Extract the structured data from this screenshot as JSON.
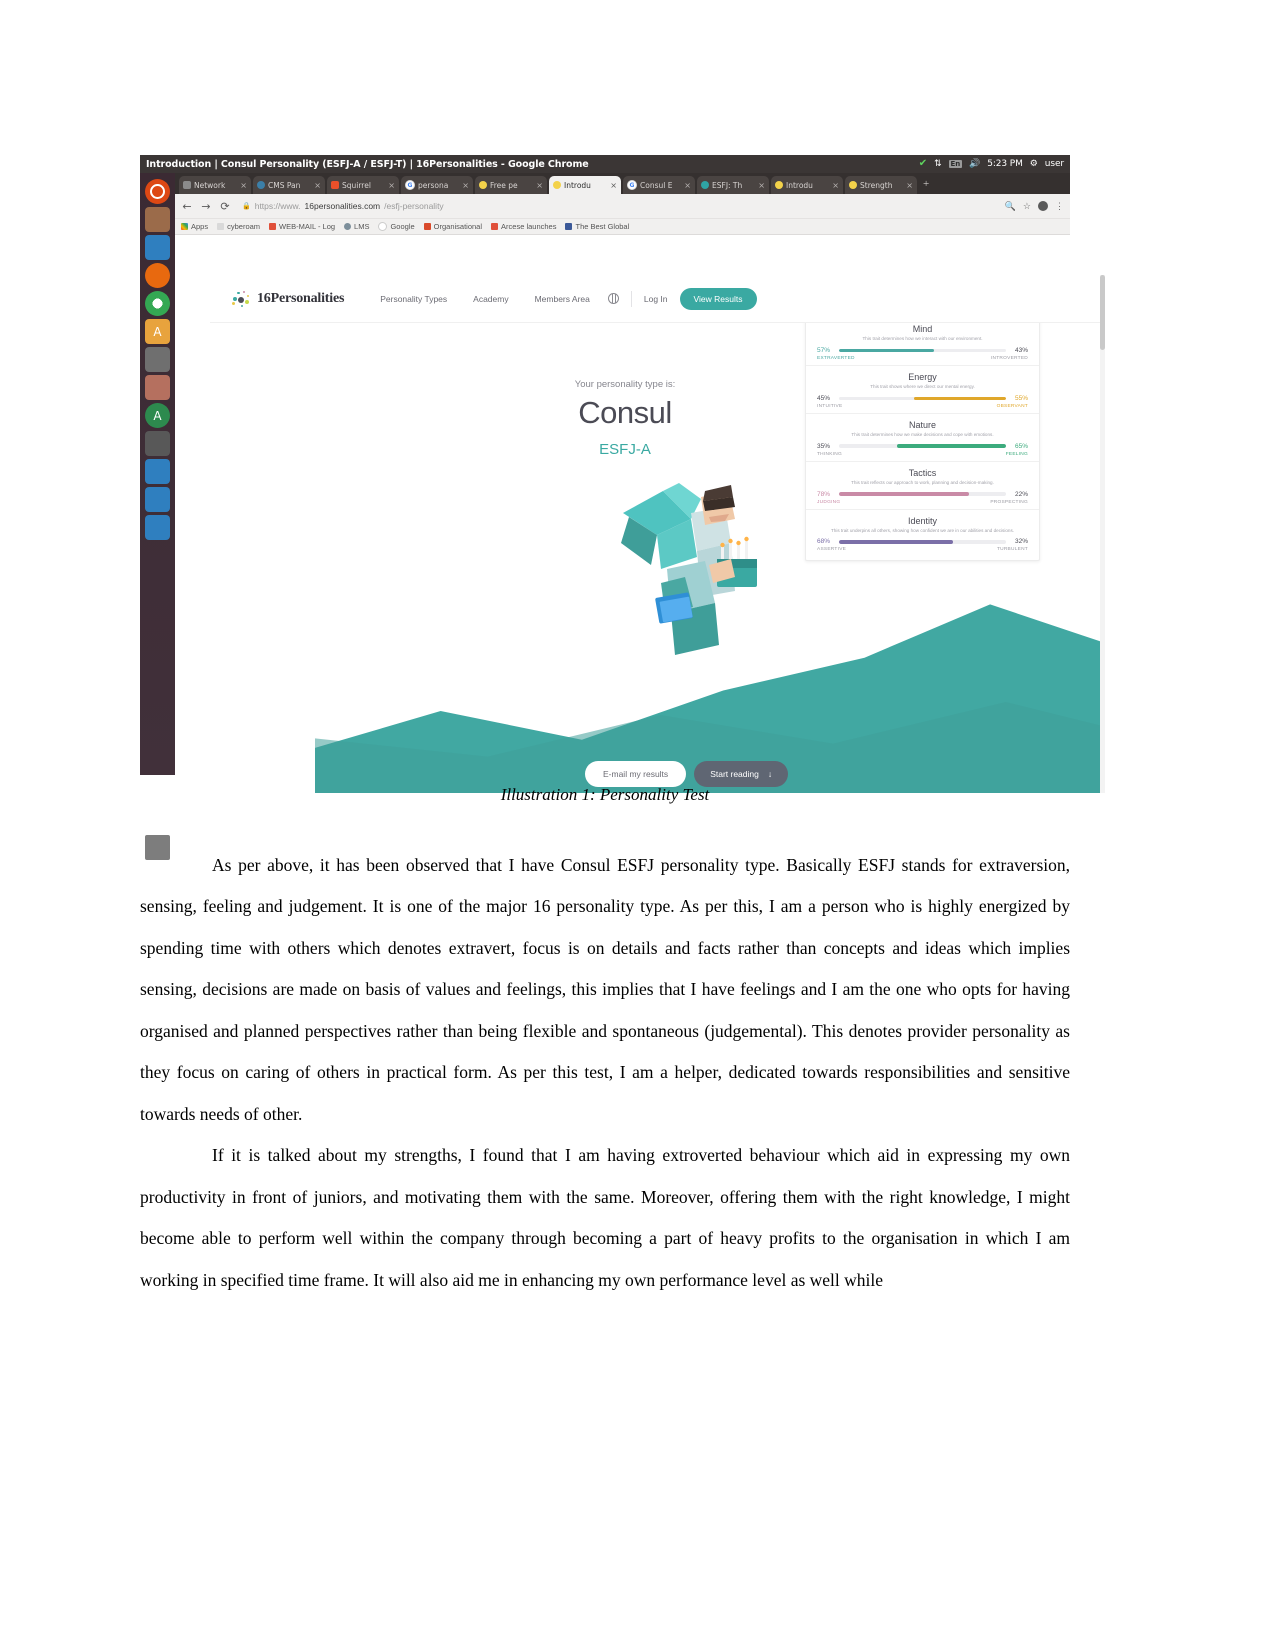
{
  "desktop": {
    "window_title": "Introduction | Consul Personality (ESFJ-A / ESFJ-T) | 16Personalities - Google Chrome",
    "clock": "5:23 PM",
    "user": "user",
    "indicators": {
      "sync": "sync-ok-icon",
      "network": "network-icon",
      "keyboard": "En",
      "volume": "volume-icon",
      "power": "power-icon"
    },
    "launcher_items": [
      "ubuntu-dash-icon",
      "files-icon",
      "folder-icon",
      "firefox-icon",
      "chrome-icon",
      "amber-app-icon",
      "wrench-icon",
      "image-app-icon",
      "android-studio-icon",
      "printer-icon",
      "blue-app-1-icon",
      "blue-app-2-icon",
      "blue-app-3-icon",
      "trash-icon"
    ]
  },
  "browser": {
    "tabs": [
      {
        "label": "Network",
        "favicon": "grey-page-icon",
        "active": false
      },
      {
        "label": "CMS Pan",
        "favicon": "cms-icon",
        "active": false
      },
      {
        "label": "Squirrel",
        "favicon": "squirrel-icon",
        "active": false
      },
      {
        "label": "persona",
        "favicon": "google-icon",
        "active": false
      },
      {
        "label": "Free pe",
        "favicon": "16p-icon",
        "active": false
      },
      {
        "label": "Introdu",
        "favicon": "16p-icon",
        "active": true
      },
      {
        "label": "Consul E",
        "favicon": "google-icon",
        "active": false
      },
      {
        "label": "ESFJ: Th",
        "favicon": "teal-icon",
        "active": false
      },
      {
        "label": "Introdu",
        "favicon": "16p-icon",
        "active": false
      },
      {
        "label": "Strength",
        "favicon": "16p-icon",
        "active": false
      }
    ],
    "new_tab_label": "+",
    "close_label": "×",
    "nav": {
      "back": "←",
      "forward": "→",
      "reload": "⟳"
    },
    "url": {
      "scheme": "https://www.",
      "domain": "16personalities.com",
      "path": "/esfj-personality"
    },
    "toolbar_right": {
      "search": "search-icon",
      "star": "☆",
      "profile": "avatar-icon",
      "menu": "⋮"
    },
    "bookmarks": [
      {
        "label": "Apps",
        "icon": "apps-grid-icon"
      },
      {
        "label": "cyberoam",
        "icon": "document-icon"
      },
      {
        "label": "WEB-MAIL - Log",
        "icon": "mail-icon"
      },
      {
        "label": "LMS",
        "icon": "lms-icon"
      },
      {
        "label": "Google",
        "icon": "google-icon"
      },
      {
        "label": "Organisational",
        "icon": "n-icon"
      },
      {
        "label": "Arcese launches",
        "icon": "red-icon"
      },
      {
        "label": "The Best Global",
        "icon": "facebook-icon"
      }
    ]
  },
  "site": {
    "logo_text": "16Personalities",
    "nav": [
      "Personality Types",
      "Academy",
      "Members Area"
    ],
    "language_icon": "globe-icon",
    "login_label": "Log In",
    "view_results_label": "View Results",
    "hero": {
      "eyebrow": "Your personality type is:",
      "type_name": "Consul",
      "type_code": "ESFJ-A",
      "email_button": "E-mail my results",
      "start_button": "Start reading",
      "start_button_icon": "↓"
    },
    "colors": {
      "teal": "#3aa9a2",
      "mind": "#4aa8a2",
      "energy": "#e0a72a",
      "nature": "#3cab7d",
      "tactics": "#c98aa6",
      "identity": "#7b6fa8",
      "hill": "#41a8a2",
      "start_button_bg": "#5f6673"
    },
    "traits": [
      {
        "title": "Mind",
        "description": "This trait determines how we interact with our environment.",
        "left_pct": "57%",
        "left_label": "EXTRAVERTED",
        "right_pct": "43%",
        "right_label": "INTROVERTED",
        "fill": 57,
        "from": "left",
        "color": "#4aa8a2"
      },
      {
        "title": "Energy",
        "description": "This trait shows where we direct our mental energy.",
        "left_pct": "45%",
        "left_label": "INTUITIVE",
        "right_pct": "55%",
        "right_label": "OBSERVANT",
        "fill": 55,
        "from": "right",
        "color": "#e0a72a"
      },
      {
        "title": "Nature",
        "description": "This trait determines how we make decisions and cope with emotions.",
        "left_pct": "35%",
        "left_label": "THINKING",
        "right_pct": "65%",
        "right_label": "FEELING",
        "fill": 65,
        "from": "right",
        "color": "#3cab7d"
      },
      {
        "title": "Tactics",
        "description": "This trait reflects our approach to work, planning and decision-making.",
        "left_pct": "78%",
        "left_label": "JUDGING",
        "right_pct": "22%",
        "right_label": "PROSPECTING",
        "fill": 78,
        "from": "left",
        "color": "#c98aa6"
      },
      {
        "title": "Identity",
        "description": "This trait underpins all others, showing how confident we are in our abilities and decisions.",
        "left_pct": "68%",
        "left_label": "ASSERTIVE",
        "right_pct": "32%",
        "right_label": "TURBULENT",
        "fill": 68,
        "from": "left",
        "color": "#7b6fa8"
      }
    ]
  },
  "caption": "Illustration 1: Personality Test",
  "document": {
    "paragraph_1": "As per above, it has been observed that I have Consul ESFJ personality type. Basically ESFJ stands for extraversion, sensing, feeling and judgement. It is one of the major 16 personality type. As per this, I am a person who is highly energized by spending time with others which denotes extravert, focus is on details and facts rather than concepts and ideas which implies sensing, decisions are made on basis of values and feelings, this implies that I have feelings and I am the one who opts for having organised and planned perspectives rather than being flexible and spontaneous (judgemental). This denotes provider personality as they focus on caring of others in practical form. As per this test, I am a helper, dedicated towards responsibilities and sensitive towards needs of other.",
    "paragraph_2": "If it is talked about my strengths, I found that I am having extroverted behaviour which aid in expressing my own productivity in front of juniors, and motivating them with the same. Moreover, offering them with the right knowledge, I might become able to perform well within the company through becoming a part of heavy profits to the organisation in which I am working in specified time frame. It will also aid me in enhancing my own performance level as well while"
  }
}
